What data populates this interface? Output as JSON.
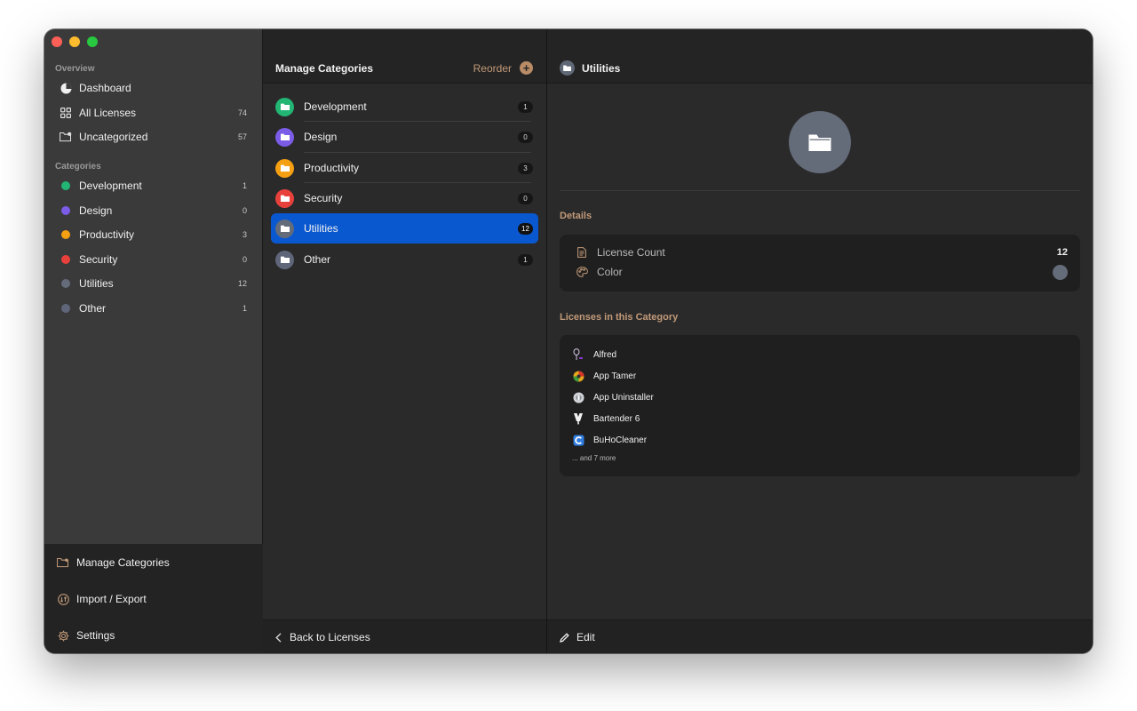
{
  "colors": {
    "close": "#fe5f57",
    "minimize": "#febc2e",
    "zoom": "#28c840",
    "accent_selected": "#0a58d0",
    "section_label": "#c29a78",
    "development": "#22b573",
    "design": "#7b5ce6",
    "productivity": "#f5a012",
    "security": "#e8413c",
    "utilities": "#646b79",
    "other": "#5f6679"
  },
  "sidebar": {
    "overview_label": "Overview",
    "overview_items": [
      {
        "label": "Dashboard",
        "icon": "chart-pie-icon",
        "count": ""
      },
      {
        "label": "All Licenses",
        "icon": "grid-icon",
        "count": "74"
      },
      {
        "label": "Uncategorized",
        "icon": "folder-badge-icon",
        "count": "57"
      }
    ],
    "categories_label": "Categories",
    "categories": [
      {
        "label": "Development",
        "count": "1",
        "color": "#22b573"
      },
      {
        "label": "Design",
        "count": "0",
        "color": "#7b5ce6"
      },
      {
        "label": "Productivity",
        "count": "3",
        "color": "#f5a012"
      },
      {
        "label": "Security",
        "count": "0",
        "color": "#e8413c"
      },
      {
        "label": "Utilities",
        "count": "12",
        "color": "#646b79"
      },
      {
        "label": "Other",
        "count": "1",
        "color": "#5f6679"
      }
    ],
    "bottom": {
      "manage": "Manage Categories",
      "import_export": "Import / Export",
      "settings": "Settings"
    }
  },
  "middle": {
    "title": "Manage Categories",
    "reorder": "Reorder",
    "categories": [
      {
        "label": "Development",
        "count": "1",
        "color": "#22b573"
      },
      {
        "label": "Design",
        "count": "0",
        "color": "#7b5ce6"
      },
      {
        "label": "Productivity",
        "count": "3",
        "color": "#f5a012"
      },
      {
        "label": "Security",
        "count": "0",
        "color": "#e8413c"
      },
      {
        "label": "Utilities",
        "count": "12",
        "color": "#646b79",
        "selected": true
      },
      {
        "label": "Other",
        "count": "1",
        "color": "#5f6679"
      }
    ],
    "back": "Back to Licenses"
  },
  "detail": {
    "title": "Utilities",
    "details_heading": "Details",
    "license_count_label": "License Count",
    "license_count_value": "12",
    "color_label": "Color",
    "licenses_heading": "Licenses in this Category",
    "licenses": [
      {
        "name": "Alfred",
        "icon": "alfred-icon"
      },
      {
        "name": "App Tamer",
        "icon": "app-tamer-icon"
      },
      {
        "name": "App Uninstaller",
        "icon": "app-uninstaller-icon"
      },
      {
        "name": "Bartender 6",
        "icon": "bartender-icon"
      },
      {
        "name": "BuHoCleaner",
        "icon": "buhocleaner-icon"
      }
    ],
    "more": "... and 7 more",
    "edit": "Edit"
  }
}
